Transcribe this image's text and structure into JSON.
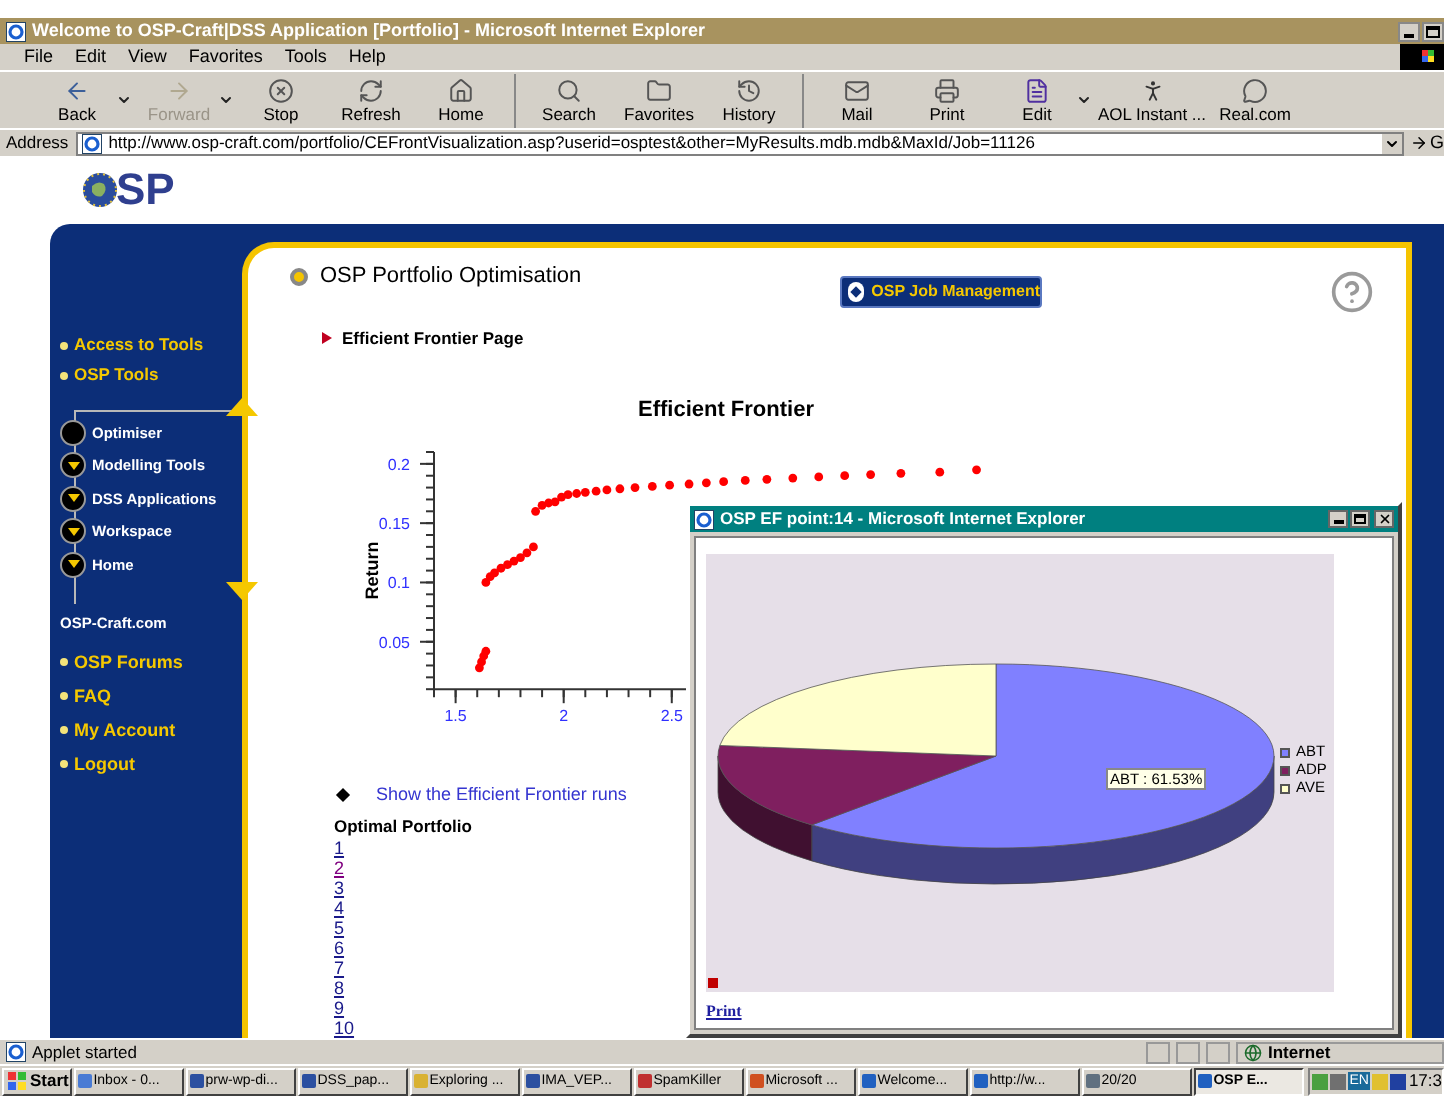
{
  "window": {
    "title": "Welcome to OSP-Craft|DSS Application [Portfolio] - Microsoft Internet Explorer"
  },
  "menu": [
    "File",
    "Edit",
    "View",
    "Favorites",
    "Tools",
    "Help"
  ],
  "toolbar": [
    [
      {
        "label": "Back",
        "kind": "back",
        "disabled": false,
        "menu": true
      },
      {
        "label": "Forward",
        "kind": "forward",
        "disabled": true,
        "menu": true
      },
      {
        "label": "Stop",
        "kind": "stop",
        "disabled": false,
        "menu": false
      },
      {
        "label": "Refresh",
        "kind": "refresh",
        "disabled": false,
        "menu": false
      },
      {
        "label": "Home",
        "kind": "home",
        "disabled": false,
        "menu": false
      }
    ],
    [
      {
        "label": "Search",
        "kind": "search",
        "disabled": false,
        "menu": false
      },
      {
        "label": "Favorites",
        "kind": "favorites",
        "disabled": false,
        "menu": false
      },
      {
        "label": "History",
        "kind": "history",
        "disabled": false,
        "menu": false
      }
    ],
    [
      {
        "label": "Mail",
        "kind": "mail",
        "disabled": false,
        "menu": false
      },
      {
        "label": "Print",
        "kind": "print",
        "disabled": false,
        "menu": false
      },
      {
        "label": "Edit",
        "kind": "edit",
        "disabled": false,
        "menu": true
      },
      {
        "label": "AOL Instant ...",
        "kind": "messenger",
        "disabled": false,
        "menu": false
      },
      {
        "label": "Real.com",
        "kind": "real",
        "disabled": false,
        "menu": false
      }
    ]
  ],
  "address": {
    "label": "Address",
    "value": "http://www.osp-craft.com/portfolio/CEFrontVisualization.asp?userid=osptest&other=MyResults.mdb.mdb&MaxId/Job=11126",
    "go": "G"
  },
  "logo": {
    "text": "SP"
  },
  "sidebar": {
    "top_links": [
      "Access to Tools",
      "OSP Tools"
    ],
    "tree": [
      {
        "label": "Optimiser",
        "selected": true
      },
      {
        "label": "Modelling Tools",
        "selected": false
      },
      {
        "label": "DSS Applications",
        "selected": false
      },
      {
        "label": "Workspace",
        "selected": false
      },
      {
        "label": "Home",
        "selected": false
      }
    ],
    "site_link": "OSP-Craft.com",
    "bottom_links": [
      "OSP Forums",
      "FAQ",
      "My Account",
      "Logout"
    ]
  },
  "content": {
    "heading": "OSP Portfolio Optimisation",
    "subheading": "Efficient Frontier Page",
    "job_button": "OSP Job Management",
    "chart_data": {
      "type": "scatter",
      "title": "Efficient Frontier",
      "ylabel": "Return",
      "xlim": [
        1.4,
        4.0
      ],
      "ylim": [
        0.01,
        0.21
      ],
      "xticks": [
        1.5,
        2,
        2.5
      ],
      "yticks": [
        0.05,
        0.1,
        0.15,
        0.2
      ],
      "x": [
        1.61,
        1.62,
        1.63,
        1.64,
        1.64,
        1.66,
        1.68,
        1.71,
        1.74,
        1.77,
        1.8,
        1.83,
        1.86,
        1.87,
        1.9,
        1.93,
        1.96,
        1.99,
        2.02,
        2.06,
        2.1,
        2.15,
        2.2,
        2.26,
        2.33,
        2.41,
        2.49,
        2.58,
        2.66,
        2.74,
        2.84,
        2.94,
        3.06,
        3.18,
        3.3,
        3.42,
        3.56,
        3.74,
        3.91
      ],
      "series": [
        {
          "color": "#ff0000",
          "values": [
            0.028,
            0.033,
            0.038,
            0.042,
            0.1,
            0.105,
            0.108,
            0.112,
            0.115,
            0.118,
            0.121,
            0.125,
            0.13,
            0.16,
            0.165,
            0.167,
            0.168,
            0.172,
            0.174,
            0.175,
            0.176,
            0.177,
            0.178,
            0.179,
            0.18,
            0.181,
            0.182,
            0.183,
            0.184,
            0.185,
            0.186,
            0.187,
            0.188,
            0.189,
            0.19,
            0.191,
            0.192,
            0.193,
            0.195
          ]
        }
      ]
    },
    "runs_link": "Show the Efficient Frontier runs",
    "portfolio_title": "Optimal Portfolio",
    "portfolios": [
      {
        "label": "1",
        "visited": false
      },
      {
        "label": "2",
        "visited": true
      },
      {
        "label": "3",
        "visited": false
      },
      {
        "label": "4",
        "visited": false
      },
      {
        "label": "5",
        "visited": false
      },
      {
        "label": "6",
        "visited": false
      },
      {
        "label": "7",
        "visited": false
      },
      {
        "label": "8",
        "visited": false
      },
      {
        "label": "9",
        "visited": false
      },
      {
        "label": "10",
        "visited": false
      }
    ]
  },
  "popup": {
    "title": "OSP EF point:14 - Microsoft Internet Explorer",
    "pie_label": "ABT : 61.53%",
    "legend": [
      {
        "label": "ABT",
        "color": "#8080ff"
      },
      {
        "label": "ADP",
        "color": "#7f1f5f"
      },
      {
        "label": "AVE",
        "color": "#ffffcc"
      }
    ],
    "print": "Print"
  },
  "status_bar": {
    "text": "Applet started",
    "zone": "Internet"
  },
  "taskbar": {
    "start": "Start",
    "tasks": [
      {
        "label": "Inbox - 0...",
        "kind": "mail",
        "selected": false
      },
      {
        "label": "prw-wp-di...",
        "kind": "word",
        "selected": false
      },
      {
        "label": "DSS_pap...",
        "kind": "word",
        "selected": false
      },
      {
        "label": "Exploring ...",
        "kind": "explorer",
        "selected": false
      },
      {
        "label": "IMA_VEP...",
        "kind": "word",
        "selected": false
      },
      {
        "label": "SpamKiller",
        "kind": "spam",
        "selected": false
      },
      {
        "label": "Microsoft ...",
        "kind": "ppt",
        "selected": false
      },
      {
        "label": "Welcome...",
        "kind": "ie",
        "selected": false
      },
      {
        "label": "http://w...",
        "kind": "ie",
        "selected": false
      },
      {
        "label": "20/20",
        "kind": "media",
        "selected": false
      },
      {
        "label": "OSP E...",
        "kind": "ie",
        "selected": true
      }
    ],
    "language": "EN",
    "clock": "17:3"
  }
}
